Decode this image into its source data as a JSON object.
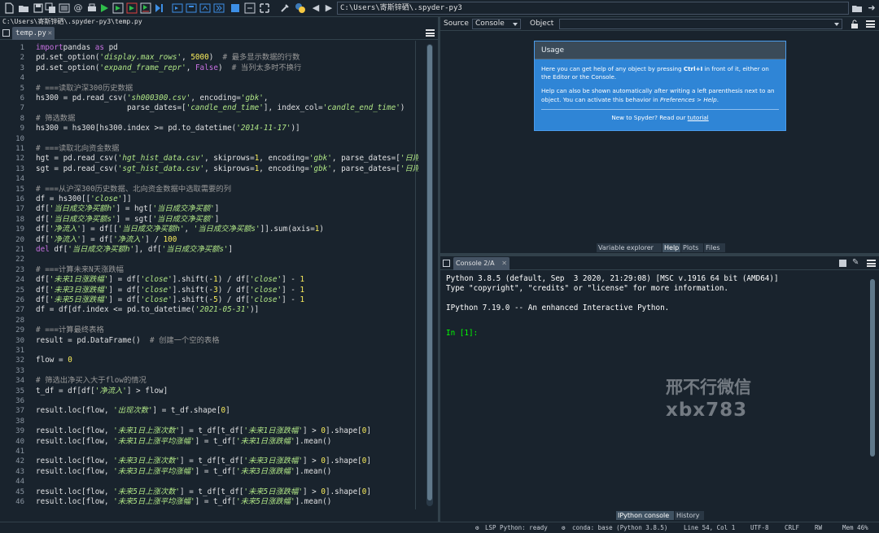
{
  "toolbar": {
    "path": "C:\\Users\\寄斯锌硒\\.spyder-py3",
    "icons": [
      "new-file-icon",
      "open-file-icon",
      "save-icon",
      "save-all-icon",
      "open-folder-icon",
      "list-icon",
      "at-icon",
      "print-icon",
      "run-icon",
      "run-file-icon",
      "run-cell-icon",
      "run-cell-advance-icon",
      "run-selection-icon",
      "debug-icon",
      "step-icon",
      "step-into-icon",
      "step-return-icon",
      "continue-icon",
      "stop-icon",
      "maximize-icon",
      "preferences-icon",
      "python-path-icon",
      "back-icon",
      "forward-icon",
      "browse-icon",
      "up-icon"
    ]
  },
  "editor": {
    "path": "C:\\Users\\寄斯锌硒\\.spyder-py3\\temp.py",
    "tab": "temp.py",
    "lines": [
      [
        [
          "k",
          "import"
        ],
        [
          "",
          "pandas"
        ],
        [
          "k",
          " as"
        ],
        [
          "",
          " pd"
        ]
      ],
      [
        [
          "",
          "pd.set_option("
        ],
        [
          "s",
          "'display.max_rows'"
        ],
        [
          "",
          ", "
        ],
        [
          "n",
          "5000"
        ],
        [
          "",
          ")  "
        ],
        [
          "c",
          "# 最多显示数据的行数"
        ]
      ],
      [
        [
          "",
          "pd.set_option("
        ],
        [
          "s",
          "'expand_frame_repr'"
        ],
        [
          "",
          ", "
        ],
        [
          "k",
          "False"
        ],
        [
          "",
          ")  "
        ],
        [
          "c",
          "# 当列太多时不换行"
        ]
      ],
      [],
      [
        [
          "c",
          "# ===读取沪深300历史数据"
        ]
      ],
      [
        [
          "",
          "hs300 = pd.read_csv("
        ],
        [
          "s",
          "'sh000300.csv'"
        ],
        [
          "",
          ", encoding="
        ],
        [
          "s",
          "'gbk'"
        ],
        [
          "",
          ","
        ]
      ],
      [
        [
          "",
          "                    parse_dates=["
        ],
        [
          "s",
          "'candle_end_time'"
        ],
        [
          "",
          "], index_col="
        ],
        [
          "s",
          "'candle_end_time'"
        ],
        [
          "",
          ")"
        ]
      ],
      [
        [
          "c",
          "# 筛选数据"
        ]
      ],
      [
        [
          "",
          "hs300 = hs300[hs300.index >= pd.to_datetime("
        ],
        [
          "s",
          "'2014-11-17'"
        ],
        [
          "",
          ")]"
        ]
      ],
      [],
      [
        [
          "c",
          "# ===读取北向资金数据"
        ]
      ],
      [
        [
          "",
          "hgt = pd.read_csv("
        ],
        [
          "s",
          "'hgt_hist_data.csv'"
        ],
        [
          "",
          ", skiprows="
        ],
        [
          "n",
          "1"
        ],
        [
          "",
          ", encoding="
        ],
        [
          "s",
          "'gbk'"
        ],
        [
          "",
          ", parse_dates=["
        ],
        [
          "s",
          "'日期'"
        ],
        [
          "",
          "])"
        ]
      ],
      [
        [
          "",
          "sgt = pd.read_csv("
        ],
        [
          "s",
          "'sgt_hist_data.csv'"
        ],
        [
          "",
          ", skiprows="
        ],
        [
          "n",
          "1"
        ],
        [
          "",
          ", encoding="
        ],
        [
          "s",
          "'gbk'"
        ],
        [
          "",
          ", parse_dates=["
        ],
        [
          "s",
          "'日期'"
        ],
        [
          "",
          "])"
        ]
      ],
      [],
      [
        [
          "c",
          "# ===从沪深300历史数据、北向资金数据中选取需要的列"
        ]
      ],
      [
        [
          "",
          "df = hs300[["
        ],
        [
          "s",
          "'close'"
        ],
        [
          "",
          "]]"
        ]
      ],
      [
        [
          "",
          "df["
        ],
        [
          "s",
          "'当日成交净买额h'"
        ],
        [
          "",
          "] = hgt["
        ],
        [
          "s",
          "'当日成交净买额'"
        ],
        [
          "",
          "]"
        ]
      ],
      [
        [
          "",
          "df["
        ],
        [
          "s",
          "'当日成交净买额s'"
        ],
        [
          "",
          "] = sgt["
        ],
        [
          "s",
          "'当日成交净买额'"
        ],
        [
          "",
          "]"
        ]
      ],
      [
        [
          "",
          "df["
        ],
        [
          "s",
          "'净流入'"
        ],
        [
          "",
          "] = df[["
        ],
        [
          "s",
          "'当日成交净买额h'"
        ],
        [
          "",
          ", "
        ],
        [
          "s",
          "'当日成交净买额s'"
        ],
        [
          "",
          "]].sum(axis="
        ],
        [
          "n",
          "1"
        ],
        [
          "",
          ")"
        ]
      ],
      [
        [
          "",
          "df["
        ],
        [
          "s",
          "'净流入'"
        ],
        [
          "",
          "] = df["
        ],
        [
          "s",
          "'净流入'"
        ],
        [
          "",
          "] / "
        ],
        [
          "n",
          "100"
        ]
      ],
      [
        [
          "k",
          "del"
        ],
        [
          "",
          " df["
        ],
        [
          "s",
          "'当日成交净买额h'"
        ],
        [
          "",
          "], df["
        ],
        [
          "s",
          "'当日成交净买额s'"
        ],
        [
          "",
          "]"
        ]
      ],
      [],
      [
        [
          "c",
          "# ===计算未来N天涨跌幅"
        ]
      ],
      [
        [
          "",
          "df["
        ],
        [
          "s",
          "'未来1日涨跌幅'"
        ],
        [
          "",
          "] = df["
        ],
        [
          "s",
          "'close'"
        ],
        [
          "",
          "].shift(-"
        ],
        [
          "n",
          "1"
        ],
        [
          "",
          ") / df["
        ],
        [
          "s",
          "'close'"
        ],
        [
          "",
          "] - "
        ],
        [
          "n",
          "1"
        ]
      ],
      [
        [
          "",
          "df["
        ],
        [
          "s",
          "'未来3日涨跌幅'"
        ],
        [
          "",
          "] = df["
        ],
        [
          "s",
          "'close'"
        ],
        [
          "",
          "].shift(-"
        ],
        [
          "n",
          "3"
        ],
        [
          "",
          ") / df["
        ],
        [
          "s",
          "'close'"
        ],
        [
          "",
          "] - "
        ],
        [
          "n",
          "1"
        ]
      ],
      [
        [
          "",
          "df["
        ],
        [
          "s",
          "'未来5日涨跌幅'"
        ],
        [
          "",
          "] = df["
        ],
        [
          "s",
          "'close'"
        ],
        [
          "",
          "].shift(-"
        ],
        [
          "n",
          "5"
        ],
        [
          "",
          ") / df["
        ],
        [
          "s",
          "'close'"
        ],
        [
          "",
          "] - "
        ],
        [
          "n",
          "1"
        ]
      ],
      [
        [
          "",
          "df = df[df.index <= pd.to_datetime("
        ],
        [
          "s",
          "'2021-05-31'"
        ],
        [
          "",
          ")]"
        ]
      ],
      [],
      [
        [
          "c",
          "# ===计算最终表格"
        ]
      ],
      [
        [
          "",
          "result = pd.DataFrame()  "
        ],
        [
          "c",
          "# 创建一个空的表格"
        ]
      ],
      [],
      [
        [
          "",
          "flow = "
        ],
        [
          "n",
          "0"
        ]
      ],
      [],
      [
        [
          "c",
          "# 筛选出净买入大于flow的情况"
        ]
      ],
      [
        [
          "",
          "t_df = df[df["
        ],
        [
          "s",
          "'净流入'"
        ],
        [
          "",
          "] > flow]"
        ]
      ],
      [],
      [
        [
          "",
          "result.loc[flow, "
        ],
        [
          "s",
          "'出现次数'"
        ],
        [
          "",
          "] = t_df.shape["
        ],
        [
          "n",
          "0"
        ],
        [
          "",
          "]"
        ]
      ],
      [],
      [
        [
          "",
          "result.loc[flow, "
        ],
        [
          "s",
          "'未来1日上涨次数'"
        ],
        [
          "",
          "] = t_df[t_df["
        ],
        [
          "s",
          "'未来1日涨跌幅'"
        ],
        [
          "",
          "] > "
        ],
        [
          "n",
          "0"
        ],
        [
          "",
          "].shape["
        ],
        [
          "n",
          "0"
        ],
        [
          "",
          "]"
        ]
      ],
      [
        [
          "",
          "result.loc[flow, "
        ],
        [
          "s",
          "'未来1日上涨平均涨幅'"
        ],
        [
          "",
          "] = t_df["
        ],
        [
          "s",
          "'未来1日涨跌幅'"
        ],
        [
          "",
          "].mean()"
        ]
      ],
      [],
      [
        [
          "",
          "result.loc[flow, "
        ],
        [
          "s",
          "'未来3日上涨次数'"
        ],
        [
          "",
          "] = t_df[t_df["
        ],
        [
          "s",
          "'未来3日涨跌幅'"
        ],
        [
          "",
          "] > "
        ],
        [
          "n",
          "0"
        ],
        [
          "",
          "].shape["
        ],
        [
          "n",
          "0"
        ],
        [
          "",
          "]"
        ]
      ],
      [
        [
          "",
          "result.loc[flow, "
        ],
        [
          "s",
          "'未来3日上涨平均涨幅'"
        ],
        [
          "",
          "] = t_df["
        ],
        [
          "s",
          "'未来3日涨跌幅'"
        ],
        [
          "",
          "].mean()"
        ]
      ],
      [],
      [
        [
          "",
          "result.loc[flow, "
        ],
        [
          "s",
          "'未来5日上涨次数'"
        ],
        [
          "",
          "] = t_df[t_df["
        ],
        [
          "s",
          "'未来5日涨跌幅'"
        ],
        [
          "",
          "] > "
        ],
        [
          "n",
          "0"
        ],
        [
          "",
          "].shape["
        ],
        [
          "n",
          "0"
        ],
        [
          "",
          "]"
        ]
      ],
      [
        [
          "",
          "result.loc[flow, "
        ],
        [
          "s",
          "'未来5日上涨平均涨幅'"
        ],
        [
          "",
          "] = t_df["
        ],
        [
          "s",
          "'未来5日涨跌幅'"
        ],
        [
          "",
          "].mean()"
        ]
      ]
    ]
  },
  "help": {
    "source_label": "Source",
    "source_value": "Console",
    "object_label": "Object",
    "object_value": "",
    "usage_title": "Usage",
    "usage_p1_a": "Here you can get help of any object by pressing ",
    "usage_p1_key": "Ctrl+I",
    "usage_p1_b": " in front of it, either on the Editor or the Console.",
    "usage_p2_a": "Help can also be shown automatically after writing a left parenthesis next to an object. You can activate this behavior in ",
    "usage_p2_pref": "Preferences > Help",
    "usage_p2_b": ".",
    "usage_foot_a": "New to Spyder? Read our ",
    "usage_foot_link": "tutorial",
    "tabs": [
      "Variable explorer",
      "Help",
      "Plots",
      "Files"
    ],
    "active_tab": "Help"
  },
  "console": {
    "tab": "Console 2/A",
    "lines": [
      "Python 3.8.5 (default, Sep  3 2020, 21:29:08) [MSC v.1916 64 bit (AMD64)]",
      "Type \"copyright\", \"credits\" or \"license\" for more information.",
      "",
      "IPython 7.19.0 -- An enhanced Interactive Python.",
      ""
    ],
    "prompt": "In [1]:",
    "tabs": [
      "IPython console",
      "History"
    ],
    "active_tab": "IPython console"
  },
  "watermark": {
    "line1": "邢不行微信",
    "line2": "xbx783"
  },
  "status": {
    "lsp": "LSP Python: ready",
    "conda": "conda: base (Python 3.8.5)",
    "position": "Line 54, Col 1",
    "encoding": "UTF-8",
    "eol": "CRLF",
    "mode": "RW",
    "mem": "Mem 46%"
  },
  "colors": {
    "background": "#19232d",
    "keyword": "#c670e0",
    "string": "#b0e686",
    "comment": "#999999",
    "number": "#faed5c",
    "usage_bg": "#2f85d6",
    "prompt": "#00ff00"
  }
}
